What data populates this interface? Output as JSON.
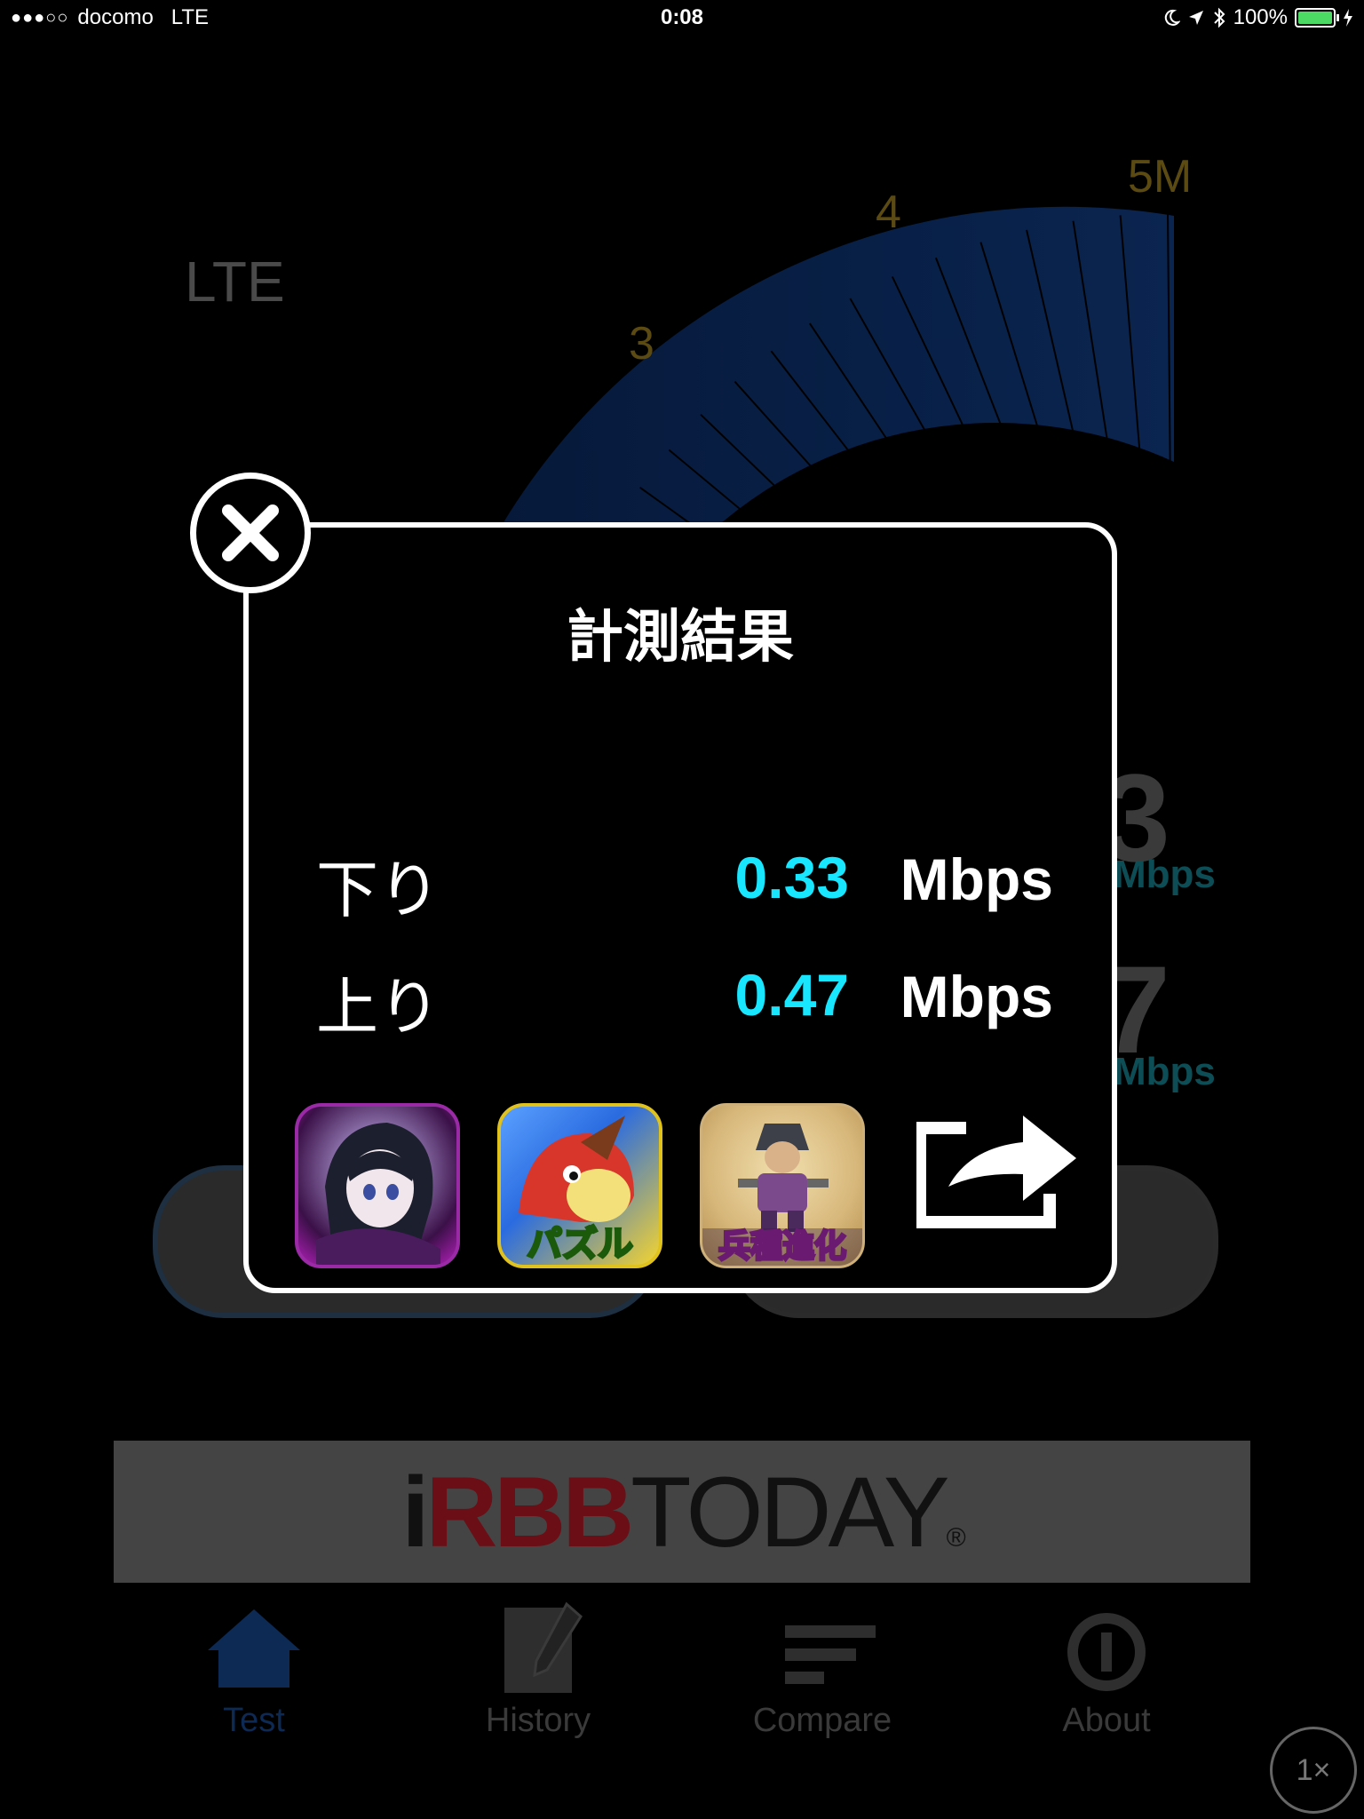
{
  "status_bar": {
    "signal": "●●●○○",
    "carrier": "docomo",
    "network": "LTE",
    "time": "0:08",
    "battery_percent": "100%",
    "battery_level": 1.0
  },
  "background": {
    "network_type": "LTE",
    "gauge_labels": [
      "3",
      "4",
      "5M"
    ],
    "download_digit": "3",
    "upload_digit": "7",
    "unit": "Mbps",
    "banner_logo": {
      "i": "i",
      "rbb": "RBB",
      "today": "TODAY",
      "reg": "®"
    }
  },
  "tabbar": {
    "tabs": [
      {
        "label": "Test",
        "icon": "home-icon",
        "active": true
      },
      {
        "label": "History",
        "icon": "notepad-icon",
        "active": false
      },
      {
        "label": "Compare",
        "icon": "bars-icon",
        "active": false
      },
      {
        "label": "About",
        "icon": "info-icon",
        "active": false
      }
    ],
    "zoom": "1×"
  },
  "modal": {
    "title": "計測結果",
    "download_label": "下り",
    "download_value": "0.33",
    "download_unit": "Mbps",
    "upload_label": "上り",
    "upload_value": "0.47",
    "upload_unit": "Mbps",
    "app_icons": [
      {
        "name": "ninja-girl-app-icon",
        "text": ""
      },
      {
        "name": "puzzle-dragon-app-icon",
        "text": "パズル"
      },
      {
        "name": "ninja-evolution-app-icon",
        "text": "兵種進化"
      }
    ]
  },
  "colors": {
    "accent_cyan": "#18e6ff",
    "tab_active": "#0d2a55",
    "banner_red": "#6b0e15"
  }
}
